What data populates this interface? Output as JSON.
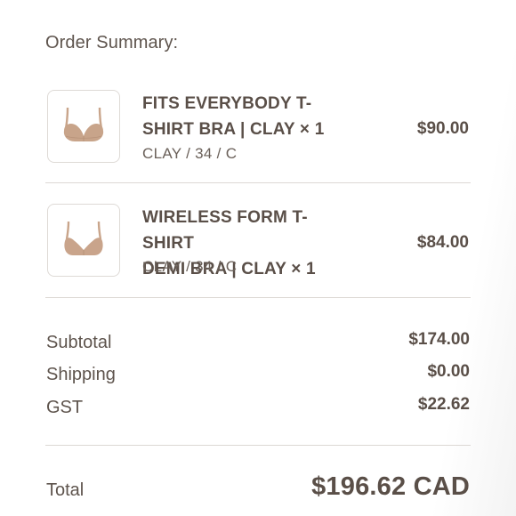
{
  "summary": {
    "heading": "Order Summary:"
  },
  "items": [
    {
      "name_line1": "FITS EVERYBODY T-",
      "name_line2": "SHIRT BRA | CLAY × 1",
      "variant": "CLAY / 34 / C",
      "price": "$90.00",
      "image_icon": "bra-product-thumbnail",
      "color": "#c8a48a"
    },
    {
      "name_line1": "WIRELESS FORM T-SHIRT",
      "name_line2": "DEMI BRA | CLAY × 1",
      "variant": "CLAY / 34 / C",
      "price": "$84.00",
      "image_icon": "bra-product-thumbnail",
      "color": "#c9a48b"
    }
  ],
  "totals": {
    "subtotal_label": "Subtotal",
    "subtotal_value": "$174.00",
    "shipping_label": "Shipping",
    "shipping_value": "$0.00",
    "gst_label": "GST",
    "gst_value": "$22.62",
    "total_label": "Total",
    "total_value": "$196.62 CAD"
  },
  "colors": {
    "text": "#5a4f48",
    "divider": "#dcd8d4",
    "product": "#c8a48a"
  }
}
